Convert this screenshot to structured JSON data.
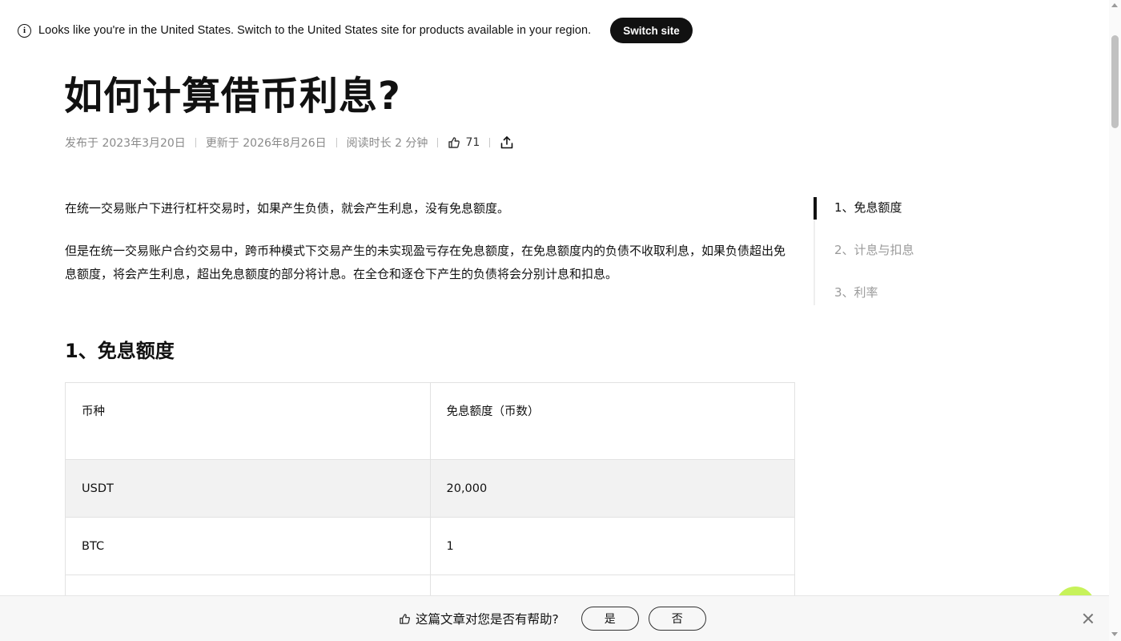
{
  "banner": {
    "icon": "info-icon",
    "text": "Looks like you're in the United States. Switch to the United States site for products available in your region.",
    "switch_label": "Switch site"
  },
  "article": {
    "title": "如何计算借币利息?",
    "meta": {
      "published": "发布于 2023年3月20日",
      "updated": "更新于 2026年8月26日",
      "read_time": "阅读时长 2 分钟",
      "likes": "71"
    },
    "paragraphs": [
      "在统一交易账户下进行杠杆交易时，如果产生负债，就会产生利息，没有免息额度。",
      "但是在统一交易账户合约交易中，跨币种模式下交易产生的未实现盈亏存在免息额度，在免息额度内的负债不收取利息，如果负债超出免息额度，将会产生利息，超出免息额度的部分将计息。在全仓和逐仓下产生的负债将会分别计息和扣息。"
    ],
    "section1_heading": "1、免息额度",
    "table": {
      "headers": [
        "币种",
        "免息额度（币数）"
      ],
      "rows": [
        [
          "USDT",
          "20,000"
        ],
        [
          "BTC",
          "1"
        ]
      ]
    }
  },
  "toc": {
    "items": [
      "1、免息额度",
      "2、计息与扣息",
      "3、利率"
    ],
    "active_index": 0
  },
  "feedback": {
    "question": "这篇文章对您是否有帮助?",
    "yes_label": "是",
    "no_label": "否"
  },
  "colors": {
    "accent_chat": "#c7f25a",
    "text": "#111111",
    "muted": "#8a8a8a",
    "table_highlight": "#f2f2f2"
  }
}
